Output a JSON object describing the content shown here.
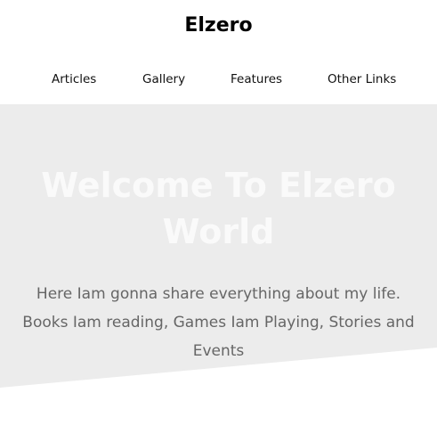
{
  "header": {
    "logo": "Elzero",
    "nav": [
      {
        "label": "Articles"
      },
      {
        "label": "Gallery"
      },
      {
        "label": "Features"
      },
      {
        "label": "Other Links"
      }
    ]
  },
  "hero": {
    "title": "Welcome To Elzero World",
    "description": "Here Iam gonna share everything about my life. Books Iam reading, Games Iam Playing, Stories and Events",
    "background_color": "#ececec",
    "title_color": "#fafafa",
    "text_color": "#666666"
  }
}
